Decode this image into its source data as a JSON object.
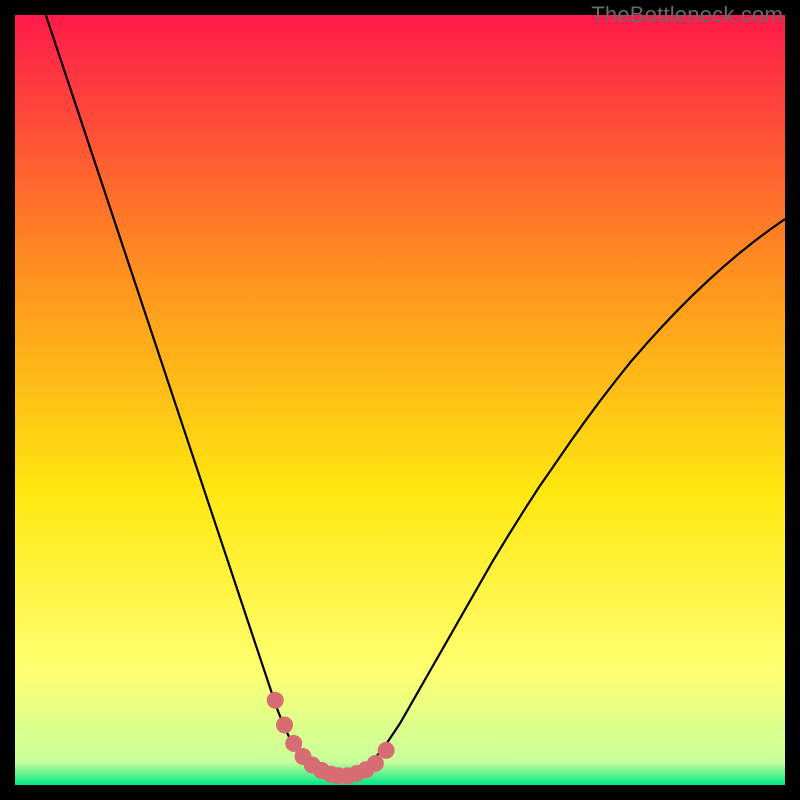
{
  "watermark": "TheBottleneck.com",
  "colors": {
    "background": "#000000",
    "gradient_top": "#ff1a4b",
    "gradient_mid1": "#ff8f1f",
    "gradient_mid2": "#ffe710",
    "gradient_mid3": "#ffff70",
    "gradient_bot": "#00e884",
    "curve": "#000000",
    "marker": "#d76d73"
  },
  "chart_data": {
    "type": "line",
    "title": "",
    "xlabel": "",
    "ylabel": "",
    "xlim": [
      0,
      100
    ],
    "ylim": [
      0,
      100
    ],
    "series": [
      {
        "name": "bottleneck-curve",
        "x": [
          4,
          6,
          8,
          10,
          12,
          14,
          16,
          18,
          20,
          22,
          24,
          26,
          28,
          30,
          32,
          33,
          34,
          35,
          36,
          37,
          38,
          39,
          40,
          41,
          42,
          43,
          44,
          45,
          46,
          48,
          50,
          52,
          54,
          56,
          58,
          60,
          62,
          64,
          66,
          68,
          70,
          72,
          74,
          76,
          78,
          80,
          82,
          84,
          86,
          88,
          90,
          92,
          94,
          96,
          98,
          100
        ],
        "y": [
          100,
          94,
          88,
          82,
          76,
          70,
          64,
          58,
          52,
          46,
          40,
          34,
          28,
          22,
          16,
          13,
          10,
          7.5,
          5.4,
          3.8,
          2.6,
          1.8,
          1.3,
          1.0,
          1.0,
          1.0,
          1.3,
          1.8,
          2.6,
          5.0,
          8.0,
          11.5,
          15.0,
          18.5,
          22.0,
          25.5,
          29.0,
          32.3,
          35.5,
          38.6,
          41.5,
          44.4,
          47.2,
          49.9,
          52.5,
          55.0,
          57.3,
          59.5,
          61.6,
          63.6,
          65.5,
          67.3,
          69.0,
          70.6,
          72.1,
          73.5
        ]
      }
    ],
    "markers": {
      "name": "highlight-dots",
      "x": [
        33.8,
        35.0,
        36.2,
        37.4,
        38.6,
        39.8,
        41.0,
        42.0,
        43.2,
        44.4,
        45.6,
        46.8,
        48.2
      ],
      "y": [
        11.0,
        7.8,
        5.4,
        3.7,
        2.6,
        1.9,
        1.4,
        1.2,
        1.2,
        1.5,
        2.0,
        2.8,
        4.5
      ]
    }
  }
}
